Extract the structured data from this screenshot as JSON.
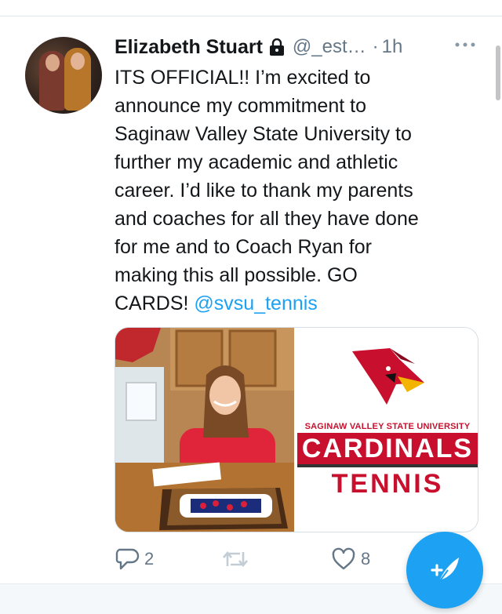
{
  "tweet": {
    "author_name": "Elizabeth Stuart",
    "handle": "@_est…",
    "separator": "·",
    "time": "1h",
    "text_lines": [
      "ITS OFFICIAL!! I’m excited to",
      "announce my commitment to",
      "Saginaw Valley State University to",
      "further my academic and athletic",
      "career. I’d like to thank my parents",
      "and coaches for all they have done",
      "for me and to Coach Ryan for",
      "making this all possible. GO"
    ],
    "last_line_prefix": "CARDS! ",
    "mention": "@svsu_tennis",
    "media": {
      "logo_university": "SAGINAW VALLEY STATE UNIVERSITY",
      "logo_cardinals": "CARDINALS",
      "logo_tennis": "TENNIS"
    },
    "actions": {
      "reply_count": "2",
      "retweet_count": "",
      "like_count": "8"
    }
  },
  "colors": {
    "accent": "#1da1f2",
    "text": "#14171a",
    "secondary": "#657786",
    "cardinal_red": "#c8102e"
  },
  "icons": {
    "lock": "lock-icon",
    "more": "more-dots-icon",
    "reply": "reply-icon",
    "retweet": "retweet-icon",
    "like": "heart-icon",
    "compose": "compose-feather-icon"
  }
}
